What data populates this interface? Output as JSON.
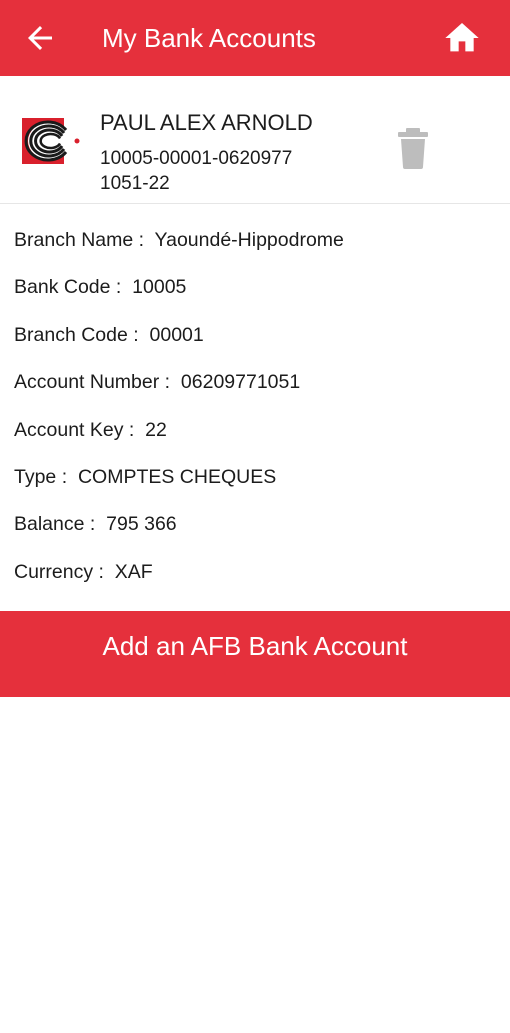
{
  "header": {
    "title": "My Bank Accounts",
    "back_icon": "arrow-left-icon",
    "home_icon": "home-icon"
  },
  "account": {
    "holder_name": "PAUL ALEX ARNOLD",
    "rib": "10005-00001-06209771051-22",
    "logo_icon": "bank-logo-icon",
    "delete_icon": "trash-icon"
  },
  "details": [
    {
      "label": "Branch Name :",
      "value": "Yaoundé-Hippodrome"
    },
    {
      "label": "Bank Code :",
      "value": "10005"
    },
    {
      "label": "Branch Code :",
      "value": "00001"
    },
    {
      "label": "Account Number :",
      "value": "06209771051"
    },
    {
      "label": "Account Key :",
      "value": "22"
    },
    {
      "label": "Type :",
      "value": "COMPTES CHEQUES"
    },
    {
      "label": "Balance :",
      "value": "795 366"
    },
    {
      "label": "Currency :",
      "value": "XAF"
    }
  ],
  "actions": {
    "add_account_label": "Add an AFB Bank Account"
  },
  "colors": {
    "brand_red": "#e5303c",
    "icon_grey": "#bdbdbd"
  }
}
